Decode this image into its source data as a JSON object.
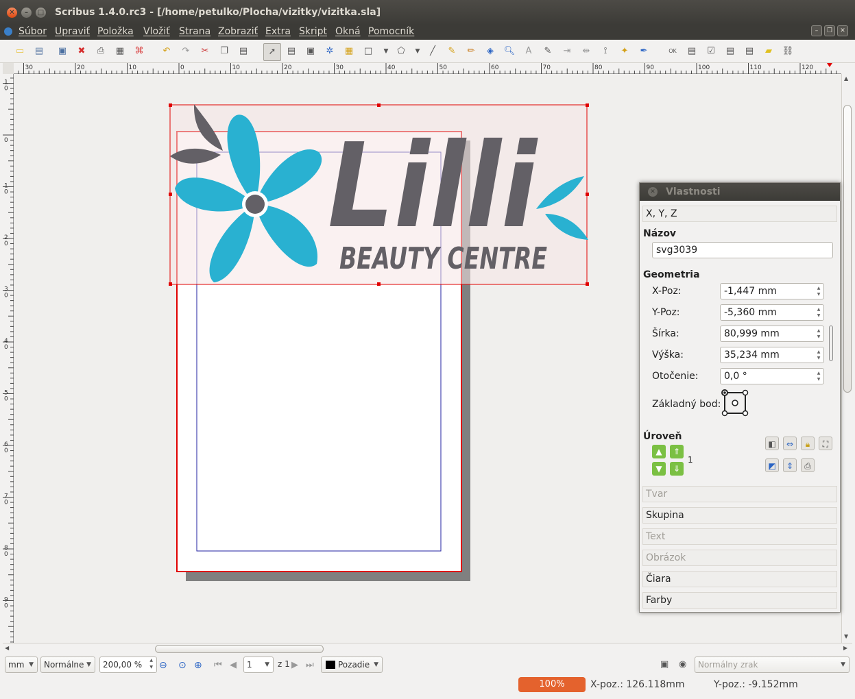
{
  "window": {
    "title": "Scribus 1.4.0.rc3 - [/home/petulko/Plocha/vizitky/vizitka.sla]"
  },
  "menu": [
    "Súbor",
    "Upraviť",
    "Položka",
    "Vložiť",
    "Strana",
    "Zobraziť",
    "Extra",
    "Skript",
    "Okná",
    "Pomocník"
  ],
  "ruler": {
    "h_labels": [
      "30",
      "20",
      "10",
      "0",
      "10",
      "20",
      "30",
      "40",
      "50",
      "60",
      "70",
      "80",
      "90",
      "100",
      "110",
      "120"
    ],
    "v_labels": [
      "1\n0",
      "0",
      "1\n0",
      "2\n0",
      "3\n0",
      "4\n0",
      "5\n0",
      "6\n0",
      "7\n0",
      "8\n0",
      "9\n0"
    ]
  },
  "logo": {
    "word": "Lilli",
    "subtitle": "BEAUTY CENTRE",
    "colors": {
      "flower": "#29b1d1",
      "text": "#636066",
      "leaves": "#636066"
    }
  },
  "properties": {
    "title": "Vlastnosti",
    "xyz_section": "X, Y, Z",
    "name_label": "Názov",
    "name_value": "svg3039",
    "geometry_label": "Geometria",
    "x_label": "X-Poz:",
    "x_value": "-1,447 mm",
    "y_label": "Y-Poz:",
    "y_value": "-5,360 mm",
    "w_label": "Šírka:",
    "w_value": "80,999 mm",
    "h_label": "Výška:",
    "h_value": "35,234 mm",
    "rot_label": "Otočenie:",
    "rot_value": "0,0 °",
    "basepoint_label": "Základný bod:",
    "level_label": "Úroveň",
    "level_value": "1",
    "sections": [
      "Tvar",
      "Skupina",
      "Text",
      "Obrázok",
      "Čiara",
      "Farby"
    ]
  },
  "bottombar": {
    "unit": "mm",
    "mode": "Normálne",
    "zoom": "200,00 %",
    "page": "1",
    "page_of": "z 1",
    "layer": "Pozadie",
    "vision": "Normálny zrak"
  },
  "statusbar": {
    "zoom": "100%",
    "xpos": "X-poz.: 126.118mm",
    "ypos": "Y-poz.: -9.152mm"
  },
  "accent": "#e4622d"
}
